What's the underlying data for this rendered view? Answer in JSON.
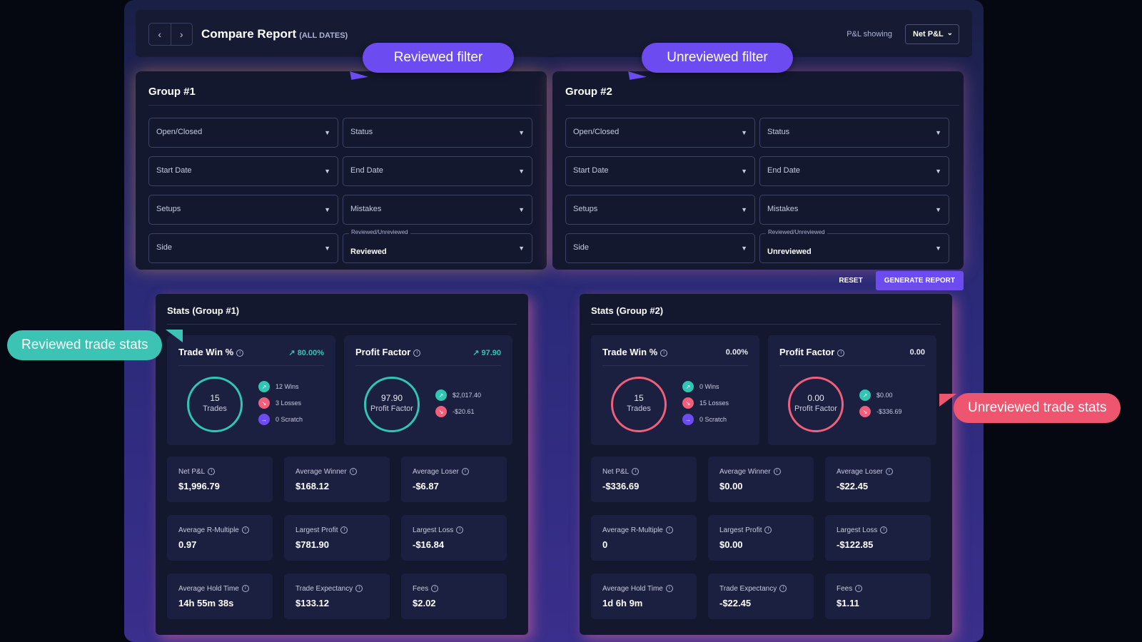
{
  "header": {
    "title": "Compare Report",
    "subtitle": "(ALL DATES)",
    "pnl_label": "P&L showing",
    "pnl_value": "Net P&L",
    "prev_icon": "chevron-left-icon",
    "next_icon": "chevron-right-icon"
  },
  "callouts": {
    "reviewed_filter": "Reviewed filter",
    "unreviewed_filter": "Unreviewed filter",
    "reviewed_stats": "Reviewed trade stats",
    "unreviewed_stats": "Unreviewed trade stats"
  },
  "groups": [
    {
      "title": "Group #1",
      "open_closed": "Open/Closed",
      "status": "Status",
      "start_date": "Start Date",
      "end_date": "End Date",
      "setups": "Setups",
      "mistakes": "Mistakes",
      "side": "Side",
      "reviewed_label": "Reviewed/Unreviewed",
      "reviewed_value": "Reviewed"
    },
    {
      "title": "Group #2",
      "open_closed": "Open/Closed",
      "status": "Status",
      "start_date": "Start Date",
      "end_date": "End Date",
      "setups": "Setups",
      "mistakes": "Mistakes",
      "side": "Side",
      "reviewed_label": "Reviewed/Unreviewed",
      "reviewed_value": "Unreviewed"
    }
  ],
  "actions": {
    "reset": "RESET",
    "generate": "GENERATE REPORT"
  },
  "stats": [
    {
      "title": "Stats (Group #1)",
      "win": {
        "label": "Trade Win %",
        "value": "80.00%",
        "trades": "15",
        "trades_label": "Trades",
        "wins": "12 Wins",
        "losses": "3 Losses",
        "scratch": "0 Scratch"
      },
      "pf": {
        "label": "Profit Factor",
        "value": "97.90",
        "ring_value": "97.90",
        "ring_label": "Profit Factor",
        "gain": "$2,017.40",
        "loss": "-$20.61"
      },
      "metrics": [
        {
          "label": "Net P&L",
          "value": "$1,996.79"
        },
        {
          "label": "Average Winner",
          "value": "$168.12"
        },
        {
          "label": "Average Loser",
          "value": "-$6.87"
        },
        {
          "label": "Average R-Multiple",
          "value": "0.97"
        },
        {
          "label": "Largest Profit",
          "value": "$781.90"
        },
        {
          "label": "Largest Loss",
          "value": "-$16.84"
        },
        {
          "label": "Average Hold Time",
          "value": "14h 55m 38s"
        },
        {
          "label": "Trade Expectancy",
          "value": "$133.12"
        },
        {
          "label": "Fees",
          "value": "$2.02"
        }
      ]
    },
    {
      "title": "Stats (Group #2)",
      "win": {
        "label": "Trade Win %",
        "value": "0.00%",
        "trades": "15",
        "trades_label": "Trades",
        "wins": "0 Wins",
        "losses": "15 Losses",
        "scratch": "0 Scratch"
      },
      "pf": {
        "label": "Profit Factor",
        "value": "0.00",
        "ring_value": "0.00",
        "ring_label": "Profit Factor",
        "gain": "$0.00",
        "loss": "-$336.69"
      },
      "metrics": [
        {
          "label": "Net P&L",
          "value": "-$336.69"
        },
        {
          "label": "Average Winner",
          "value": "$0.00"
        },
        {
          "label": "Average Loser",
          "value": "-$22.45"
        },
        {
          "label": "Average R-Multiple",
          "value": "0"
        },
        {
          "label": "Largest Profit",
          "value": "$0.00"
        },
        {
          "label": "Largest Loss",
          "value": "-$122.85"
        },
        {
          "label": "Average Hold Time",
          "value": "1d 6h 9m"
        },
        {
          "label": "Trade Expectancy",
          "value": "-$22.45"
        },
        {
          "label": "Fees",
          "value": "$1.11"
        }
      ]
    }
  ],
  "colors": {
    "accent": "#6c4cf0",
    "positive": "#2fc6b6",
    "negative": "#f0607a"
  }
}
